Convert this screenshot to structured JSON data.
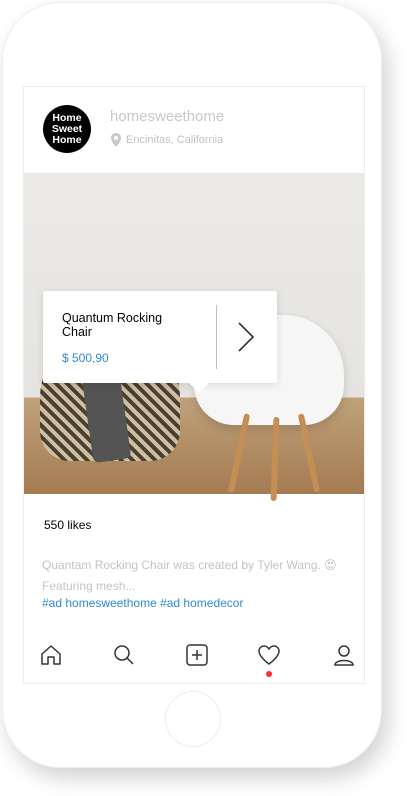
{
  "profile": {
    "avatar_text_1": "Home",
    "avatar_text_2": "Sweet",
    "avatar_text_3": "Home",
    "username": "homesweethome",
    "location": "Encinitas, California"
  },
  "product": {
    "title": "Quantum Rocking Chair",
    "price": "$ 500,90"
  },
  "post": {
    "likes": "550 likes",
    "caption_line1": "Quantam Rocking Chair was created by Tyler Wang.",
    "emoji": "😍",
    "caption_line2": "Featuring mesh...",
    "tags": "#ad  homesweethome #ad  homedecor"
  },
  "tabs": [
    "home-icon",
    "search-icon",
    "add-icon",
    "heart-icon",
    "profile-icon"
  ],
  "colors": {
    "link": "#2f8ad3",
    "notification": "#ff2d2d"
  }
}
